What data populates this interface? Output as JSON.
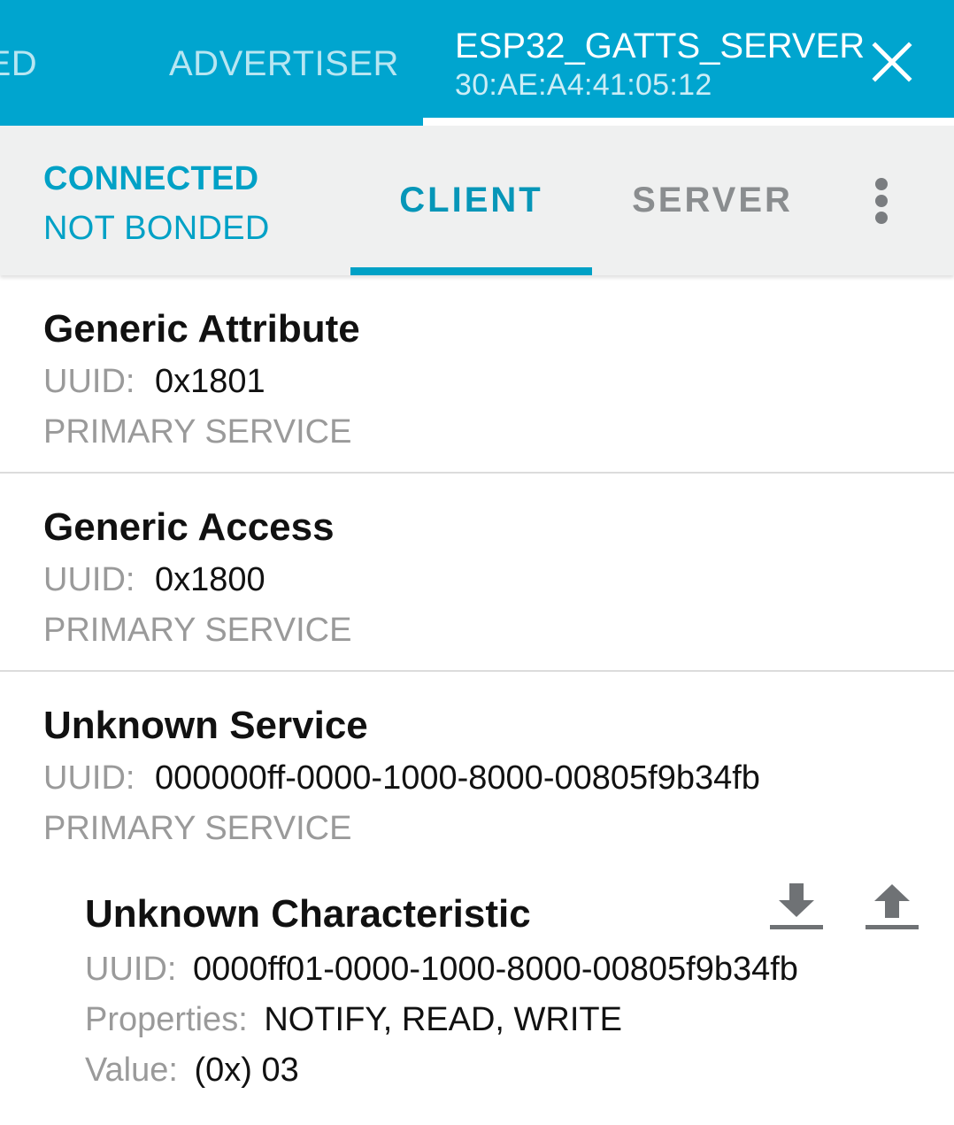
{
  "top_tabs": {
    "bonded_label": "BONDED",
    "advertiser_label": "ADVERTISER"
  },
  "device": {
    "name": "ESP32_GATTS_SERVER",
    "address": "30:AE:A4:41:05:12",
    "close_icon": "close-icon"
  },
  "status": {
    "connection": "CONNECTED",
    "bond": "NOT BONDED"
  },
  "sub_tabs": {
    "client_label": "CLIENT",
    "server_label": "SERVER",
    "active": "CLIENT",
    "menu_icon": "more-vertical-icon"
  },
  "services": [
    {
      "name": "Generic Attribute",
      "uuid_label": "UUID:",
      "uuid": "0x1801",
      "type": "PRIMARY SERVICE"
    },
    {
      "name": "Generic Access",
      "uuid_label": "UUID:",
      "uuid": "0x1800",
      "type": "PRIMARY SERVICE"
    },
    {
      "name": "Unknown Service",
      "uuid_label": "UUID:",
      "uuid": "000000ff-0000-1000-8000-00805f9b34fb",
      "type": "PRIMARY SERVICE"
    }
  ],
  "characteristic": {
    "name": "Unknown Characteristic",
    "uuid_label": "UUID:",
    "uuid": "0000ff01-0000-1000-8000-00805f9b34fb",
    "properties_label": "Properties:",
    "properties": "NOTIFY, READ, WRITE",
    "value_label": "Value:",
    "value": "(0x) 03",
    "read_icon": "download-icon",
    "write_icon": "upload-icon"
  },
  "colors": {
    "primary": "#00a5cf",
    "accent": "#00a1c6",
    "subbar_bg": "#eff0f0",
    "secondary_text": "#9a9a9a"
  }
}
